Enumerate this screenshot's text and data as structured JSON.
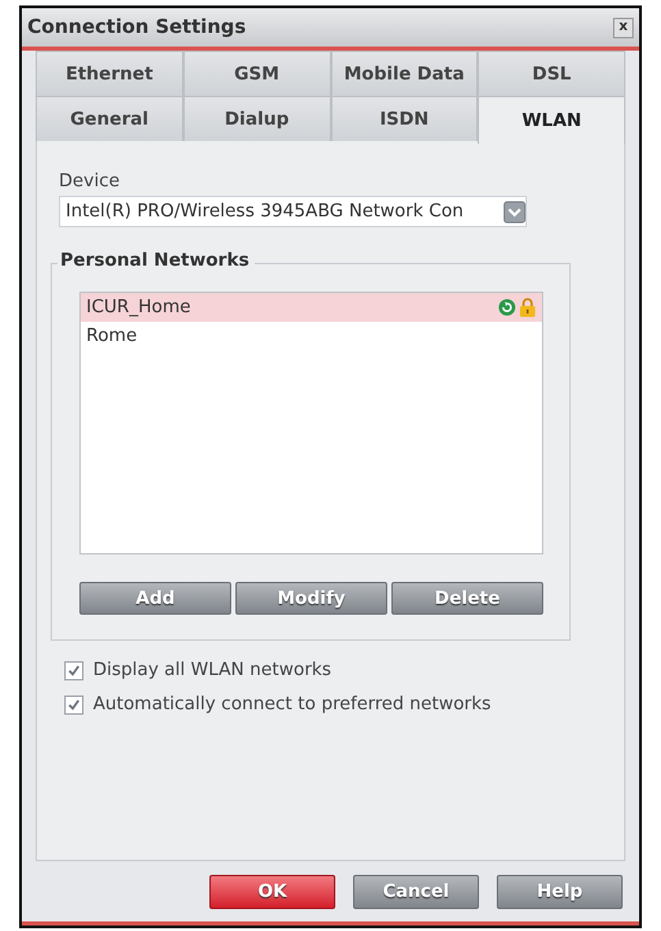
{
  "window": {
    "title": "Connection Settings",
    "close": "x"
  },
  "tab_rows": [
    [
      {
        "label": "Ethernet",
        "selected": false
      },
      {
        "label": "GSM",
        "selected": false
      },
      {
        "label": "Mobile Data",
        "selected": false
      },
      {
        "label": "DSL",
        "selected": false
      }
    ],
    [
      {
        "label": "General",
        "selected": false
      },
      {
        "label": "Dialup",
        "selected": false
      },
      {
        "label": "ISDN",
        "selected": false
      },
      {
        "label": "WLAN",
        "selected": true
      }
    ]
  ],
  "device": {
    "label": "Device",
    "value": "Intel(R) PRO/Wireless 3945ABG Network Con"
  },
  "personal_networks": {
    "title": "Personal Networks",
    "items": [
      {
        "name": "ICUR_Home",
        "selected": true
      },
      {
        "name": "Rome",
        "selected": false
      }
    ],
    "buttons": [
      "Add",
      "Modify",
      "Delete"
    ]
  },
  "options": [
    {
      "label": "Display all WLAN networks",
      "checked": true
    },
    {
      "label": "Automatically connect to preferred networks",
      "checked": true
    }
  ],
  "buttons": [
    {
      "label": "OK",
      "kind": "primary"
    },
    {
      "label": "Cancel",
      "kind": "normal"
    },
    {
      "label": "Help",
      "kind": "normal"
    }
  ]
}
